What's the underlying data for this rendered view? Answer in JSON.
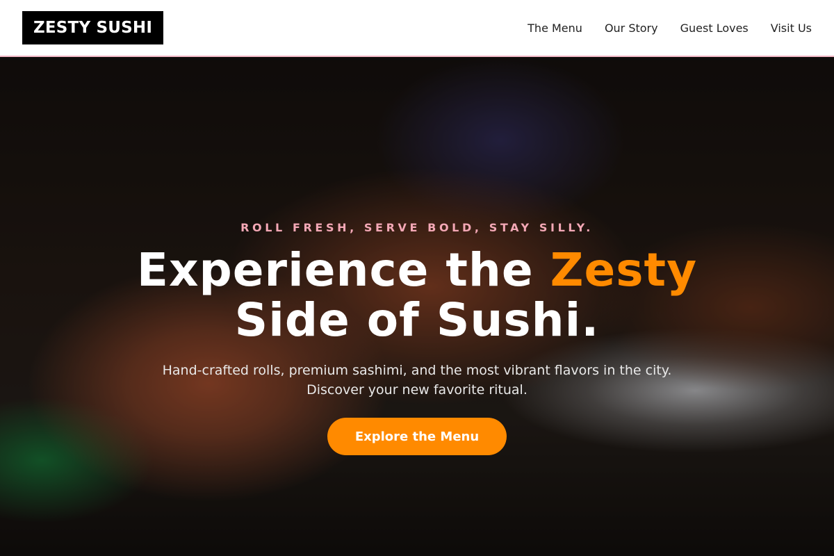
{
  "brand": {
    "logo_text": "ZESTY SUSHI"
  },
  "nav": {
    "items": [
      {
        "label": "The Menu"
      },
      {
        "label": "Our Story"
      },
      {
        "label": "Guest Loves"
      },
      {
        "label": "Visit Us"
      }
    ]
  },
  "hero": {
    "tagline": "ROLL FRESH, SERVE BOLD, STAY SILLY.",
    "headline_part1": "Experience the",
    "headline_accent": "Zesty",
    "headline_line2": "Side of Sushi.",
    "subtitle_line1": "Hand-crafted rolls, premium sashimi, and the most vibrant flavors in the city.",
    "subtitle_line2": "Discover your new favorite ritual.",
    "cta_label": "Explore the Menu",
    "background_image": "sushi-rolls-photo"
  },
  "colors": {
    "accent": "#ff8a00",
    "tagline_pink": "#f4a8b6",
    "nav_border": "#f2b8c6",
    "logo_bg": "#000000"
  }
}
